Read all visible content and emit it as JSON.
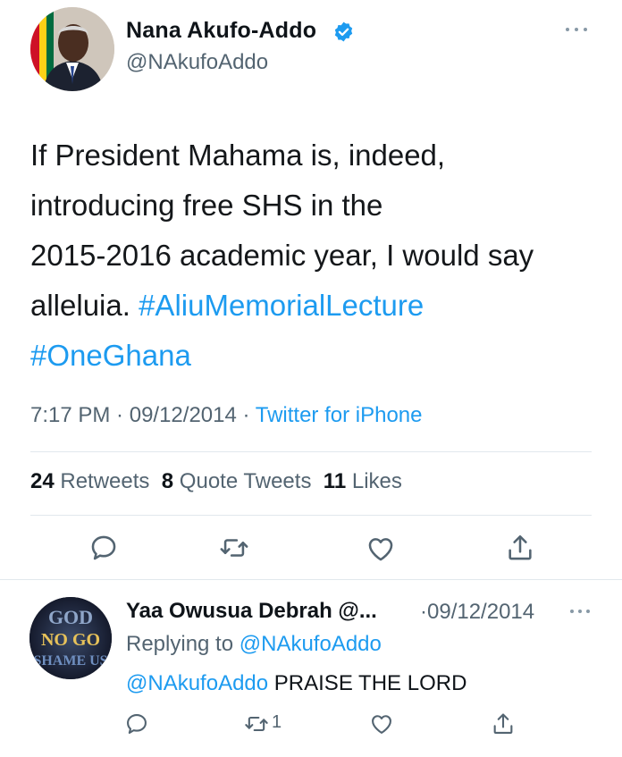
{
  "tweet": {
    "author_name": "Nana Akufo-Addo",
    "author_handle": "@NAkufoAddo",
    "verified": true,
    "text_lines": [
      "If President Mahama is, indeed,",
      "introducing free SHS in the",
      "2015-2016 academic year, I would say"
    ],
    "text_last_plain": "alleluia. ",
    "hashtag_1": "#AliuMemorialLecture",
    "hashtag_2": "#OneGhana",
    "time": "7:17 PM",
    "date": "09/12/2014",
    "source": "Twitter for iPhone",
    "separator": " · ",
    "stats": {
      "retweets_count": "24",
      "retweets_label": "Retweets",
      "quote_tweets_count": "8",
      "quote_tweets_label": "Quote Tweets",
      "likes_count": "11",
      "likes_label": "Likes"
    },
    "icons": [
      "reply-icon",
      "retweet-icon",
      "like-icon",
      "share-icon"
    ]
  },
  "reply": {
    "author_name": "Yaa Owusua Debrah @...",
    "date": "·09/12/2014",
    "replying_prefix": "Replying to ",
    "replying_to": "@NAkufoAddo",
    "mention": "@NAkufoAddo",
    "text": " PRAISE THE LORD",
    "retweet_count": "1",
    "avatar_text_lines": [
      "GOD",
      "NO GO",
      "SHAME US"
    ]
  },
  "colors": {
    "link": "#1d9bf0",
    "secondary_text": "#536471",
    "primary_text": "#0f1419",
    "divider": "#e1e8ed"
  }
}
